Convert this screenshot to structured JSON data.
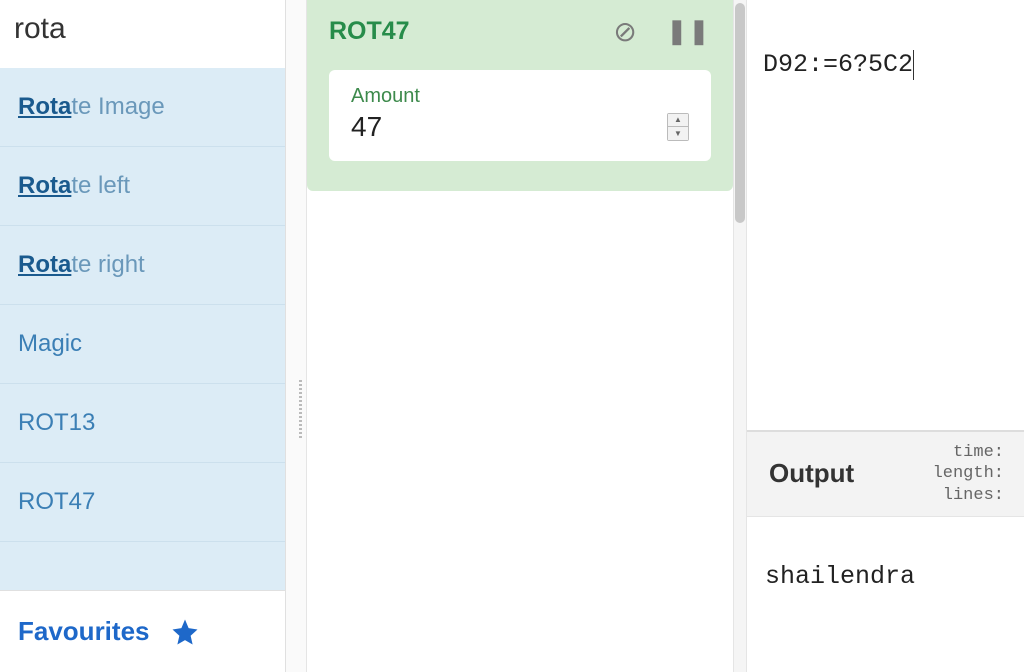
{
  "sidebar": {
    "search_value": "rota",
    "ops": [
      {
        "prefix": "Rota",
        "rest": "te Image",
        "highlight": true
      },
      {
        "prefix": "Rota",
        "rest": "te left",
        "highlight": true
      },
      {
        "prefix": "Rota",
        "rest": "te right",
        "highlight": true
      },
      {
        "prefix": "",
        "rest": "Magic",
        "highlight": false
      },
      {
        "prefix": "",
        "rest": "ROT13",
        "highlight": false
      },
      {
        "prefix": "",
        "rest": "ROT47",
        "highlight": false
      }
    ],
    "favourites_label": "Favourites"
  },
  "recipe": {
    "op_title": "ROT47",
    "arg_label": "Amount",
    "arg_value": "47"
  },
  "input": {
    "text": "D92:=6?5C2"
  },
  "output": {
    "header_label": "Output",
    "stat_time_label": "time:",
    "stat_length_label": "length:",
    "stat_lines_label": "lines:",
    "text": "shailendra"
  }
}
